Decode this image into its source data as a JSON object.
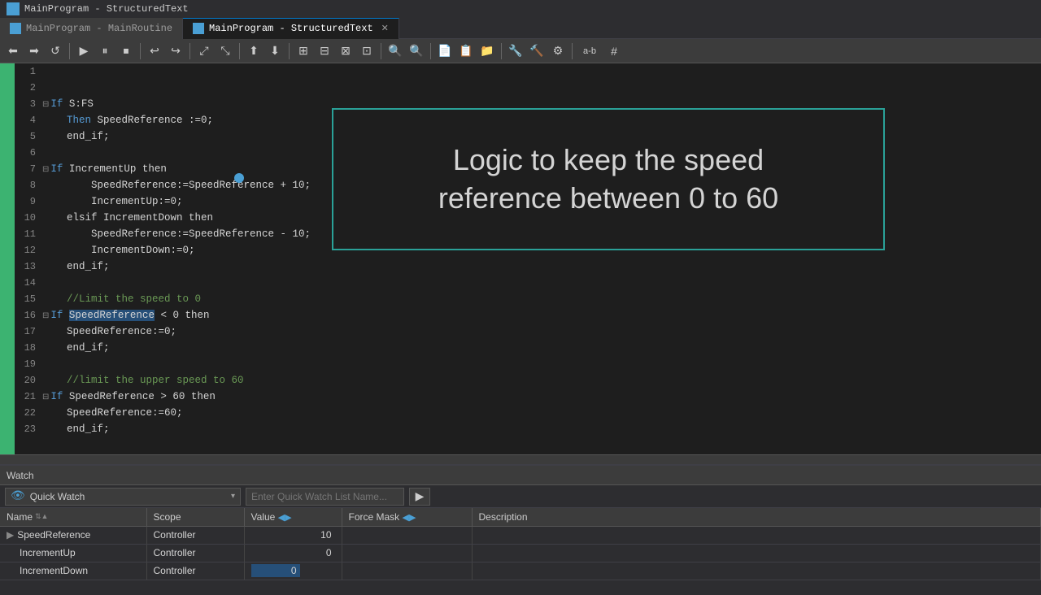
{
  "titlebar": {
    "tab1": {
      "label": "MainProgram - MainRoutine",
      "active": false
    },
    "tab2": {
      "label": "MainProgram - StructuredText",
      "active": true
    }
  },
  "toolbar": {
    "buttons": [
      "⟵",
      "⟶",
      "↺",
      "▶",
      "⏸",
      "⏹",
      "↩",
      "↪",
      "⤢",
      "⤡",
      "⬆",
      "⬇",
      "⊞",
      "⊟",
      "⊠",
      "⊡",
      "⤶",
      "⤷",
      "🔍+",
      "🔍-",
      "📄",
      "📋",
      "📁",
      "🔧",
      "🔨",
      "⚙",
      "a-b",
      "#"
    ]
  },
  "code": {
    "lines": [
      {
        "num": 1,
        "text": ""
      },
      {
        "num": 2,
        "text": ""
      },
      {
        "num": 3,
        "collapse": true,
        "text": "If S:FS",
        "keyword": "If",
        "rest": " S:FS"
      },
      {
        "num": 4,
        "text": "    Then SpeedReference :=0;"
      },
      {
        "num": 5,
        "text": "    end_if;"
      },
      {
        "num": 6,
        "text": ""
      },
      {
        "num": 7,
        "collapse": true,
        "text": "If IncrementUp then",
        "keyword": "If",
        "rest": " IncrementUp then"
      },
      {
        "num": 8,
        "text": "        SpeedReference:=SpeedReference + 10;"
      },
      {
        "num": 9,
        "text": "        IncrementUp:=0;"
      },
      {
        "num": 10,
        "text": "    elsif IncrementDown then"
      },
      {
        "num": 11,
        "text": "        SpeedReference:=SpeedReference - 10;"
      },
      {
        "num": 12,
        "text": "        IncrementDown:=0;"
      },
      {
        "num": 13,
        "text": "    end_if;"
      },
      {
        "num": 14,
        "text": ""
      },
      {
        "num": 15,
        "text": "    //Limit the speed to 0",
        "comment": true
      },
      {
        "num": 16,
        "collapse": true,
        "text": "If SpeedReference < 0 then",
        "selected": "SpeedReference",
        "keyword": "If",
        "rest": " < 0 then"
      },
      {
        "num": 17,
        "text": "    SpeedReference:=0;"
      },
      {
        "num": 18,
        "text": "    end_if;"
      },
      {
        "num": 19,
        "text": ""
      },
      {
        "num": 20,
        "text": "    //limit the upper speed to 60",
        "comment": true
      },
      {
        "num": 21,
        "collapse": true,
        "text": "If SpeedReference > 60 then"
      },
      {
        "num": 22,
        "text": "    SpeedReference:=60;"
      },
      {
        "num": 23,
        "text": "    end_if;"
      }
    ]
  },
  "annotation": {
    "line1": "Logic to keep the speed",
    "line2": "reference between 0 to 60"
  },
  "watch": {
    "panel_title": "Watch",
    "dropdown_label": "Quick Watch",
    "name_placeholder": "Enter Quick Watch List Name...",
    "go_btn": "▶",
    "columns": [
      "Name",
      "Scope",
      "Value",
      "Force Mask",
      "Description"
    ],
    "rows": [
      {
        "expand": true,
        "name": "SpeedReference",
        "scope": "Controller",
        "value": "10",
        "force_mask": "",
        "description": ""
      },
      {
        "expand": false,
        "name": "IncrementUp",
        "scope": "Controller",
        "value": "0",
        "force_mask": "",
        "description": ""
      },
      {
        "expand": false,
        "name": "IncrementDown",
        "scope": "Controller",
        "value": "0",
        "force_mask": "",
        "description": "",
        "value_input": true
      }
    ]
  }
}
